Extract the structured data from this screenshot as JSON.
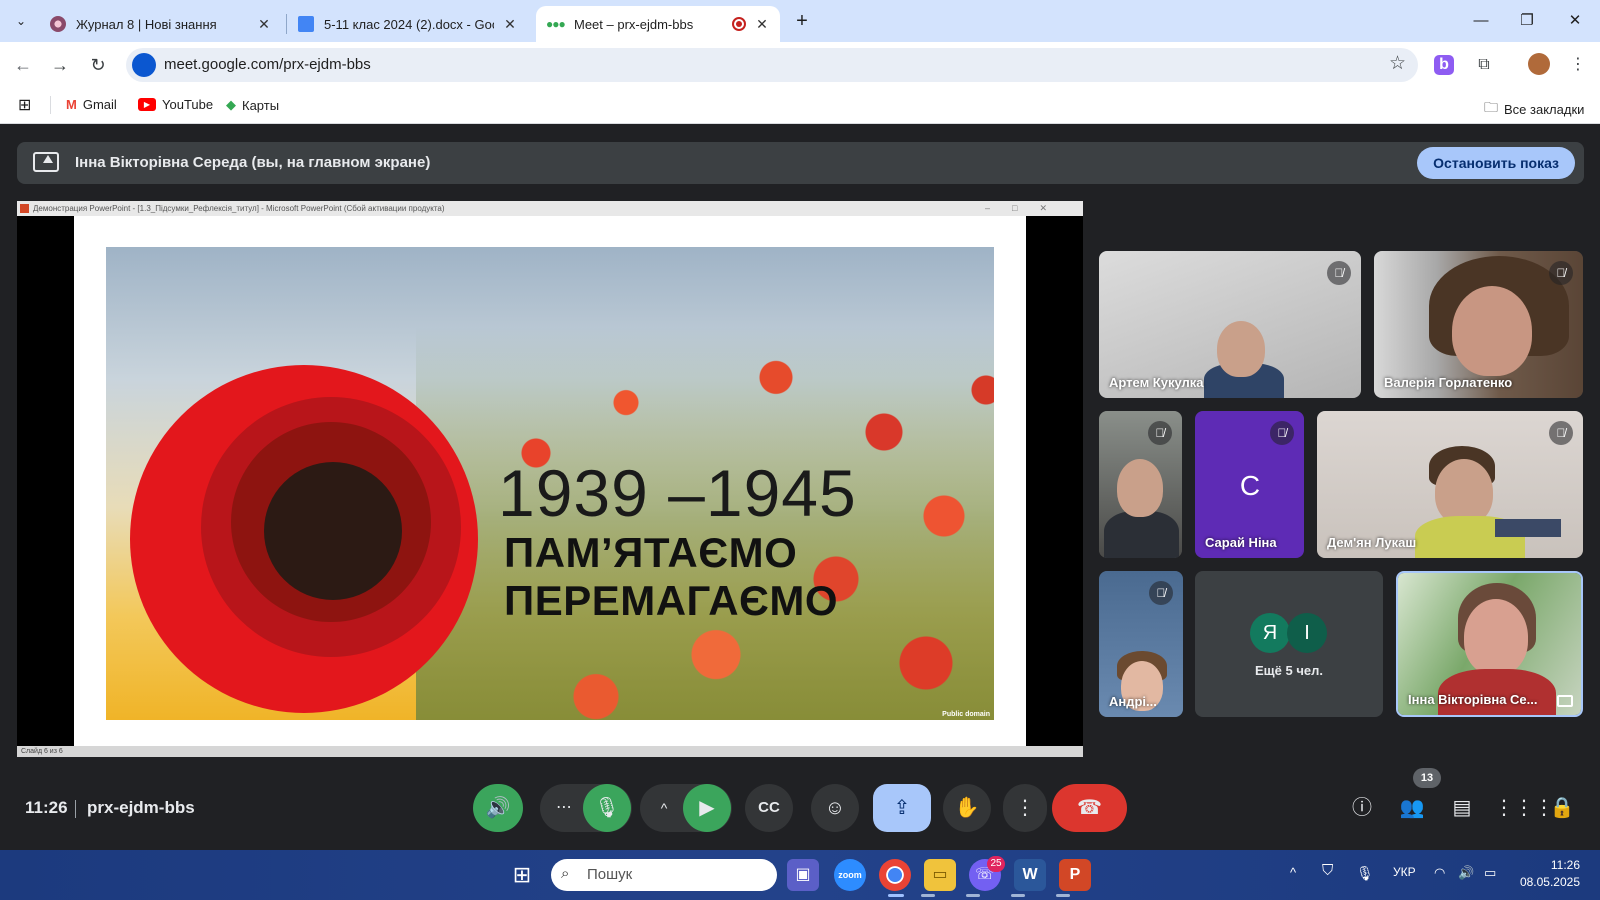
{
  "browser": {
    "tabs": [
      {
        "title": "Журнал 8 | Нові знання",
        "active": false
      },
      {
        "title": "5-11 клас 2024 (2).docx - Goog",
        "active": false
      },
      {
        "title": "Meet – prx-ejdm-bbs",
        "active": true
      }
    ],
    "address": "meet.google.com/prx-ejdm-bbs",
    "bookmarks": [
      "Gmail",
      "YouTube",
      "Карты"
    ],
    "all_bookmarks": "Все закладки"
  },
  "meet": {
    "presenting_banner": "Інна Вікторівна Середа (вы, на главном экране)",
    "stop_button": "Остановить показ",
    "shared_window_title": "Демонстрация PowerPoint - [1.3_Підсумки_Рефлексія_титул] - Microsoft PowerPoint (Сбой активации продукта)",
    "slide_status": "Слайд 6 из 6",
    "slide": {
      "years": "1939 –1945",
      "line1": "ПАМ’ЯТАЄМО",
      "line2": "ПЕРЕМАГАЄМО",
      "credit": "Public domain"
    },
    "participants": [
      {
        "name": "Артем Кукулка",
        "muted": true
      },
      {
        "name": "Валерія Горлатенко",
        "muted": true
      },
      {
        "name": "",
        "muted": true
      },
      {
        "name": "Сарай Ніна",
        "muted": true,
        "initial": "С",
        "color": "#5e2bb5"
      },
      {
        "name": "Дем'ян Лукаш",
        "muted": true
      },
      {
        "name": "Андрі...",
        "muted": true
      },
      {
        "name": "Інна Вікторівна Се...",
        "muted": false
      }
    ],
    "more_participants": {
      "label": "Ещё 5 чел.",
      "initials": [
        "Я",
        "І"
      ]
    },
    "time": "11:26",
    "meeting_code": "prx-ejdm-bbs",
    "people_count": "13"
  },
  "taskbar": {
    "search_placeholder": "Пошук",
    "viber_badge": "25",
    "language": "УКР",
    "clock_time": "11:26",
    "clock_date": "08.05.2025"
  },
  "colors": {
    "accent_green": "#3ba55c",
    "end_call_red": "#dc362e",
    "present_blue": "#a8c7fa"
  }
}
